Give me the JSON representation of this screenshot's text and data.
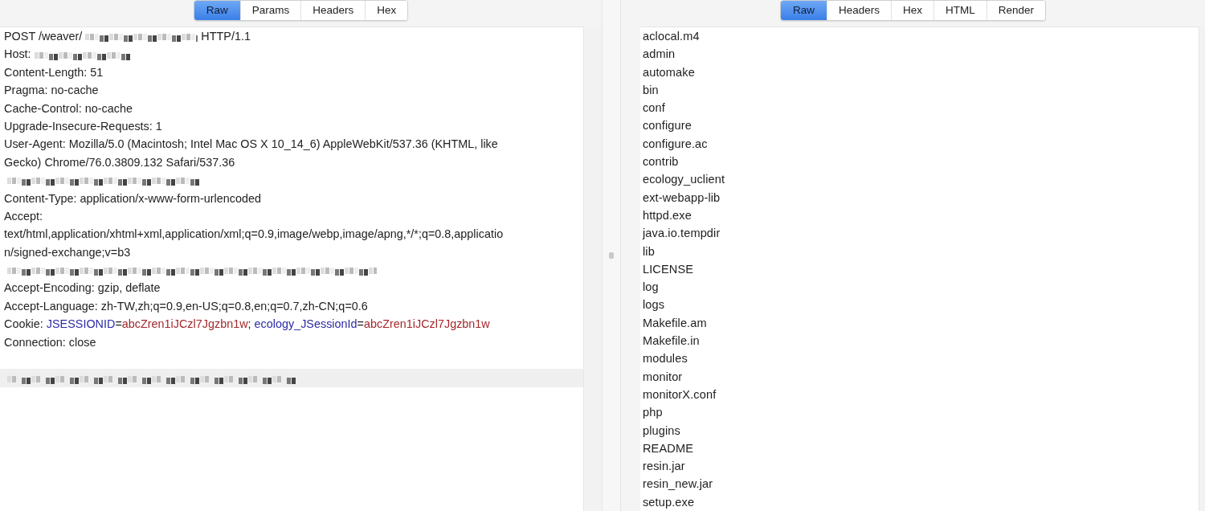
{
  "request": {
    "tabs": [
      {
        "label": "Raw",
        "selected": true
      },
      {
        "label": "Params",
        "selected": false
      },
      {
        "label": "Headers",
        "selected": false
      },
      {
        "label": "Hex",
        "selected": false
      }
    ],
    "lines": [
      {
        "highlighted": false,
        "segments": [
          {
            "kind": "text",
            "text": "POST /weaver/"
          },
          {
            "kind": "redacted"
          },
          {
            "kind": "text",
            "text": "HTTP/1.1"
          }
        ]
      },
      {
        "highlighted": false,
        "segments": [
          {
            "kind": "text",
            "text": "Host:"
          },
          {
            "kind": "redacted"
          }
        ]
      },
      {
        "highlighted": false,
        "segments": [
          {
            "kind": "text",
            "text": "Content-Length: 51"
          }
        ]
      },
      {
        "highlighted": false,
        "segments": [
          {
            "kind": "text",
            "text": "Pragma: no-cache"
          }
        ]
      },
      {
        "highlighted": false,
        "segments": [
          {
            "kind": "text",
            "text": "Cache-Control: no-cache"
          }
        ]
      },
      {
        "highlighted": false,
        "segments": [
          {
            "kind": "text",
            "text": "Upgrade-Insecure-Requests: 1"
          }
        ]
      },
      {
        "highlighted": false,
        "segments": [
          {
            "kind": "text",
            "text": "User-Agent: Mozilla/5.0 (Macintosh; Intel Mac OS X 10_14_6) AppleWebKit/537.36 (KHTML, like"
          }
        ]
      },
      {
        "highlighted": false,
        "segments": [
          {
            "kind": "text",
            "text": "Gecko) Chrome/76.0.3809.132 Safari/537.36"
          }
        ]
      },
      {
        "highlighted": false,
        "segments": [
          {
            "kind": "redacted"
          }
        ]
      },
      {
        "highlighted": false,
        "segments": [
          {
            "kind": "text",
            "text": "Content-Type: application/x-www-form-urlencoded"
          }
        ]
      },
      {
        "highlighted": false,
        "segments": [
          {
            "kind": "text",
            "text": "Accept:"
          }
        ]
      },
      {
        "highlighted": false,
        "segments": [
          {
            "kind": "text",
            "text": "text/html,application/xhtml+xml,application/xml;q=0.9,image/webp,image/apng,*/*;q=0.8,applicatio"
          }
        ]
      },
      {
        "highlighted": false,
        "segments": [
          {
            "kind": "text",
            "text": "n/signed-exchange;v=b3"
          }
        ]
      },
      {
        "highlighted": false,
        "segments": [
          {
            "kind": "redacted"
          }
        ]
      },
      {
        "highlighted": false,
        "segments": [
          {
            "kind": "text",
            "text": "Accept-Encoding: gzip, deflate"
          }
        ]
      },
      {
        "highlighted": false,
        "segments": [
          {
            "kind": "text",
            "text": "Accept-Language: zh-TW,zh;q=0.9,en-US;q=0.8,en;q=0.7,zh-CN;q=0.6"
          }
        ]
      },
      {
        "highlighted": false,
        "segments": [
          {
            "kind": "text",
            "text": "Cookie: "
          },
          {
            "kind": "name",
            "text": "JSESSIONID"
          },
          {
            "kind": "text",
            "text": "="
          },
          {
            "kind": "value",
            "text": "abcZren1iJCzl7Jgzbn1w"
          },
          {
            "kind": "text",
            "text": "; "
          },
          {
            "kind": "name",
            "text": "ecology_JSessionId"
          },
          {
            "kind": "text",
            "text": "="
          },
          {
            "kind": "value",
            "text": "abcZren1iJCzl7Jgzbn1w"
          }
        ]
      },
      {
        "highlighted": false,
        "segments": [
          {
            "kind": "text",
            "text": "Connection: close"
          }
        ]
      },
      {
        "highlighted": true,
        "segments": [
          {
            "kind": "redacted"
          }
        ]
      }
    ]
  },
  "response": {
    "tabs": [
      {
        "label": "Raw",
        "selected": true
      },
      {
        "label": "Headers",
        "selected": false
      },
      {
        "label": "Hex",
        "selected": false
      },
      {
        "label": "HTML",
        "selected": false
      },
      {
        "label": "Render",
        "selected": false
      }
    ],
    "lines": [
      "aclocal.m4",
      "admin",
      "automake",
      "bin",
      "conf",
      "configure",
      "configure.ac",
      "contrib",
      "ecology_uclient",
      "ext-webapp-lib",
      "httpd.exe",
      "java.io.tempdir",
      "lib",
      "LICENSE",
      "log",
      "logs",
      "Makefile.am",
      "Makefile.in",
      "modules",
      "monitor",
      "monitorX.conf",
      "php",
      "plugins",
      "README",
      "resin.jar",
      "resin_new.jar",
      "setup.exe"
    ]
  }
}
